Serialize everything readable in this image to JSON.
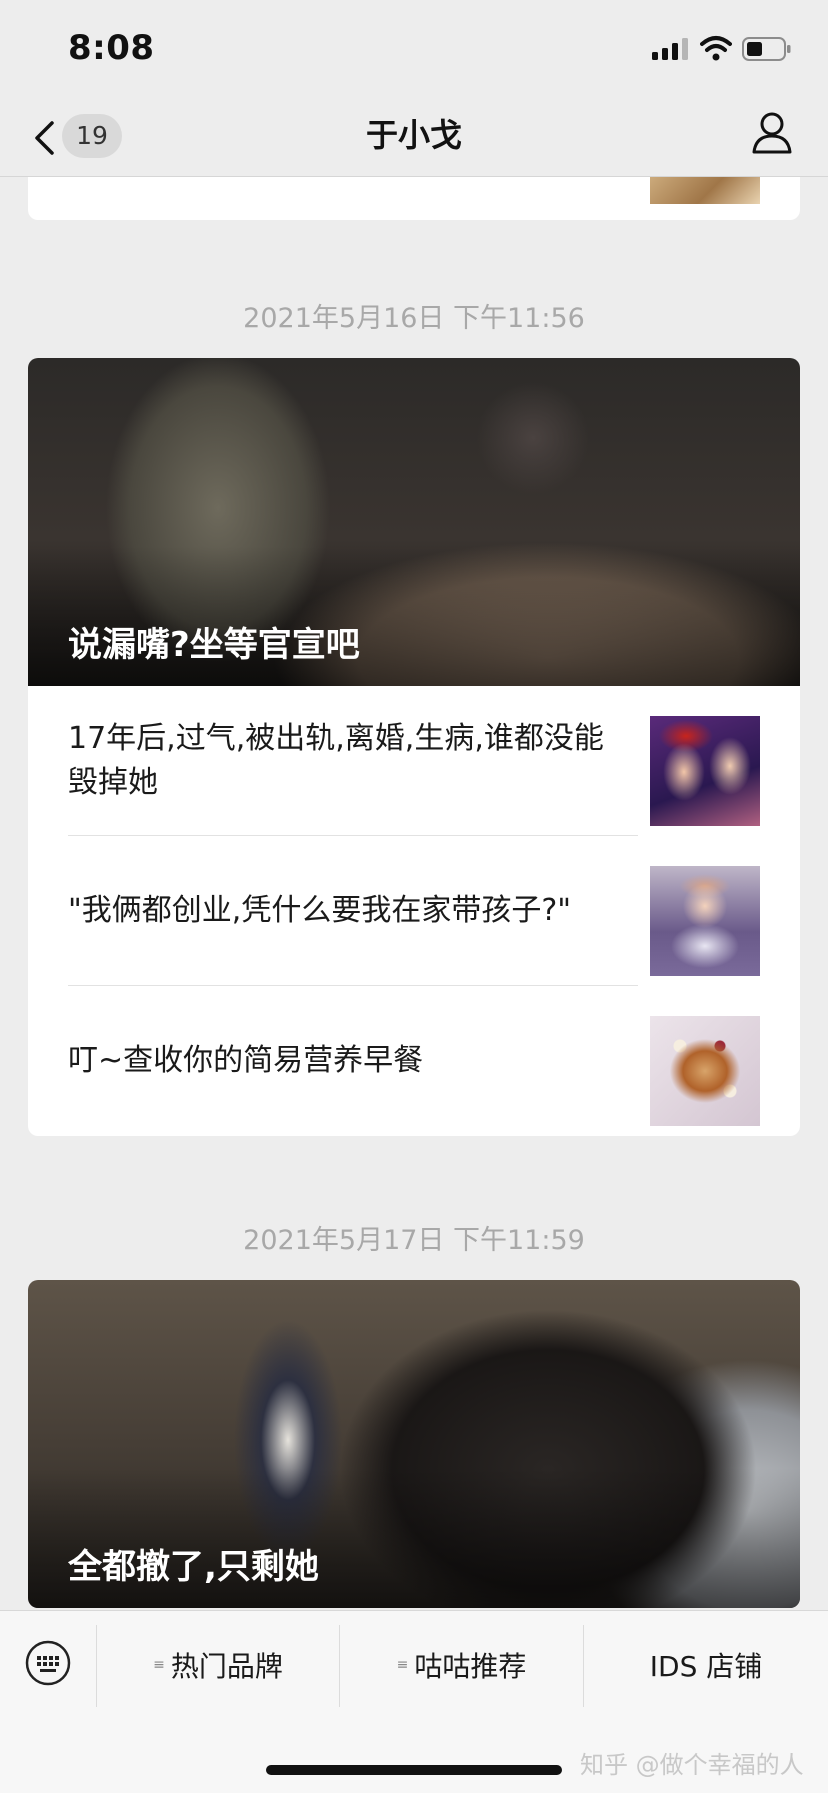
{
  "status_bar": {
    "time": "8:08"
  },
  "nav": {
    "badge_count": "19",
    "title": "于小戈"
  },
  "feed": [
    {
      "timestamp": "2021年5月16日 下午11:56",
      "hero_title": "说漏嘴?坐等官宣吧",
      "items": [
        {
          "title": "17年后,过气,被出轨,离婚,生病,谁都没能毁掉她"
        },
        {
          "title": "\"我俩都创业,凭什么要我在家带孩子?\""
        },
        {
          "title": "叮~查收你的简易营养早餐"
        }
      ]
    },
    {
      "timestamp": "2021年5月17日 下午11:59",
      "hero_title": "全都撤了,只剩她"
    }
  ],
  "bottom_menu": [
    {
      "label": "热门品牌",
      "has_submenu": true
    },
    {
      "label": "咕咕推荐",
      "has_submenu": true
    },
    {
      "label": "IDS 店铺",
      "has_submenu": false
    }
  ],
  "watermark": "知乎 @做个幸福的人"
}
